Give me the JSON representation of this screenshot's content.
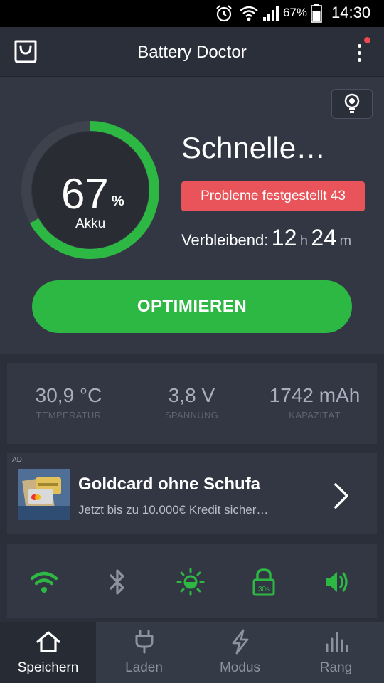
{
  "status_bar": {
    "battery_percent": "67%",
    "time": "14:30",
    "icons": [
      "alarm-icon",
      "wifi-icon",
      "signal-icon",
      "battery-icon"
    ]
  },
  "app_bar": {
    "title": "Battery Doctor",
    "left_icon": "shopping-bag-icon",
    "right_icon": "more-vertical-icon",
    "has_notification_dot": true
  },
  "hero": {
    "tip_icon": "lightbulb-icon",
    "battery": {
      "value": "67",
      "unit": "%",
      "label": "Akku",
      "level": 0.67
    },
    "mode_title": "Schnelle…",
    "problems_badge": "Probleme festgestellt 43",
    "remaining": {
      "label": "Verbleibend:",
      "hours": "12",
      "hours_unit": "h",
      "minutes": "24",
      "minutes_unit": "m"
    },
    "optimize_label": "OPTIMIEREN"
  },
  "stats": [
    {
      "value": "30,9 °C",
      "label": "TEMPERATUR"
    },
    {
      "value": "3,8 V",
      "label": "SPANNUNG"
    },
    {
      "value": "1742 mAh",
      "label": "KAPAZITÄT"
    }
  ],
  "ad": {
    "tag": "AD",
    "title": "Goldcard ohne Schufa",
    "subtitle": "Jetzt bis zu 10.000€ Kredit sicher…"
  },
  "toggles": [
    {
      "name": "wifi-toggle",
      "icon": "wifi-icon",
      "active": true
    },
    {
      "name": "bluetooth-toggle",
      "icon": "bluetooth-icon",
      "active": false
    },
    {
      "name": "brightness-toggle",
      "icon": "brightness-icon",
      "active": true
    },
    {
      "name": "screen-timeout-toggle",
      "icon": "lock-timer-icon",
      "active": true,
      "value": "30s"
    },
    {
      "name": "sound-toggle",
      "icon": "speaker-icon",
      "active": true
    }
  ],
  "nav": [
    {
      "label": "Speichern",
      "icon": "home-icon",
      "active": true
    },
    {
      "label": "Laden",
      "icon": "plug-icon",
      "active": false
    },
    {
      "label": "Modus",
      "icon": "lightning-icon",
      "active": false
    },
    {
      "label": "Rang",
      "icon": "bar-chart-icon",
      "active": false
    }
  ],
  "colors": {
    "accent_green": "#2db843",
    "badge_red": "#e8545a",
    "background": "#2b2f39",
    "panel": "#323743"
  }
}
